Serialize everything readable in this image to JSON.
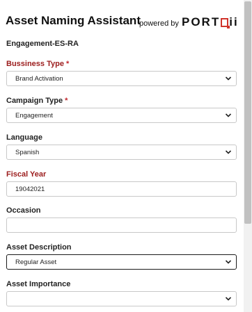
{
  "header": {
    "title": "Asset Naming Assistant",
    "powered_by": "powered by",
    "logo_left": "PORT",
    "logo_right": "ii",
    "accent_color": "#d0342c"
  },
  "subtitle": "Engagement-ES-RA",
  "fields": {
    "business_type": {
      "label": "Bussiness Type",
      "required_mark": "*",
      "value": "Brand Activation"
    },
    "campaign_type": {
      "label": "Campaign Type",
      "required_mark": "*",
      "value": "Engagement"
    },
    "language": {
      "label": "Language",
      "value": "Spanish"
    },
    "fiscal_year": {
      "label": "Fiscal Year",
      "value": "19042021"
    },
    "occasion": {
      "label": "Occasion",
      "value": ""
    },
    "asset_description": {
      "label": "Asset Description",
      "value": "Regular Asset"
    },
    "asset_importance": {
      "label": "Asset Importance",
      "value": ""
    }
  },
  "icons": {
    "select": "chevron-down-icon"
  },
  "colors": {
    "required_label": "#9b1c1c",
    "required_star": "#c0272d"
  }
}
